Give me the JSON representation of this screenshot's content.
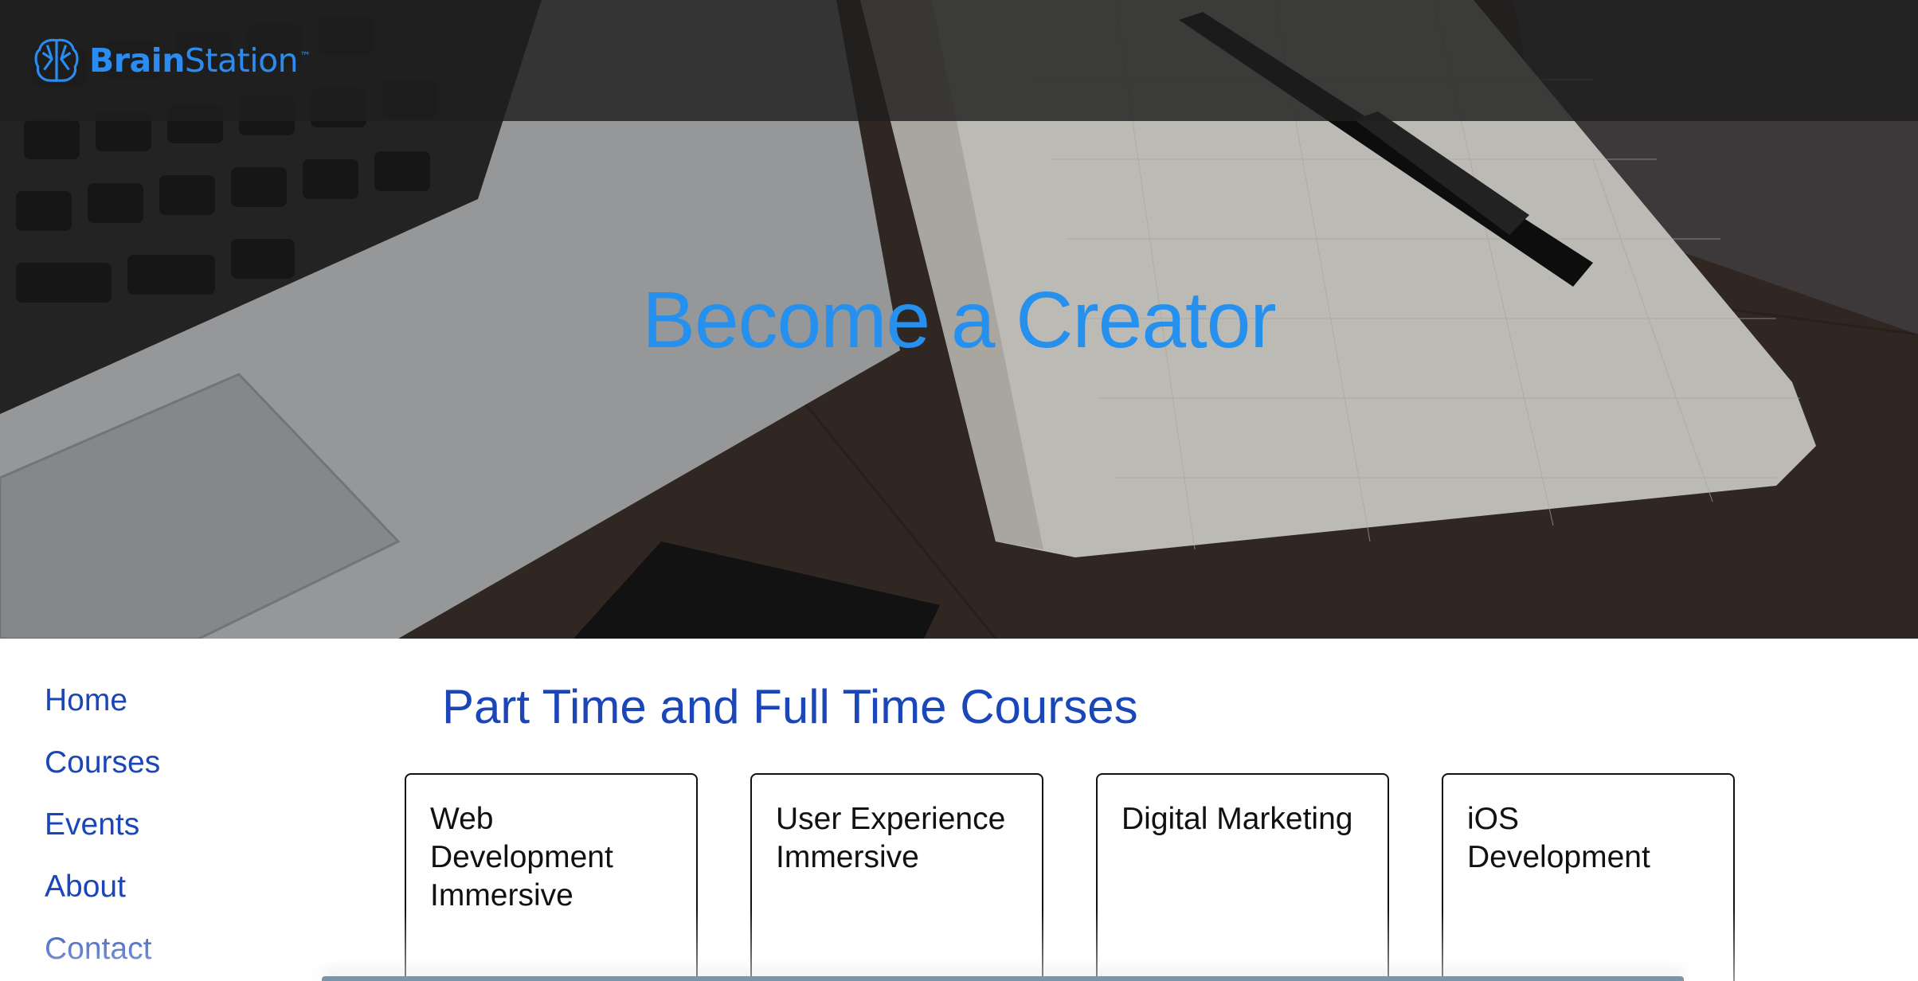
{
  "brand": {
    "name_bold": "Brain",
    "name_regular": "Station",
    "trademark": "™",
    "icon": "brain-logo-icon",
    "color": "#2a8cf0"
  },
  "hero": {
    "title": "Become a Creator",
    "title_color": "#2590ee"
  },
  "sidebar": {
    "items": [
      {
        "label": "Home"
      },
      {
        "label": "Courses"
      },
      {
        "label": "Events"
      },
      {
        "label": "About"
      },
      {
        "label": "Contact"
      }
    ],
    "color": "#1b46b8"
  },
  "main": {
    "title": "Part Time and Full Time Courses",
    "courses": [
      {
        "title": "Web Development Immersive"
      },
      {
        "title": "User Experience Immersive"
      },
      {
        "title": "Digital Marketing"
      },
      {
        "title": "iOS Development"
      }
    ]
  }
}
